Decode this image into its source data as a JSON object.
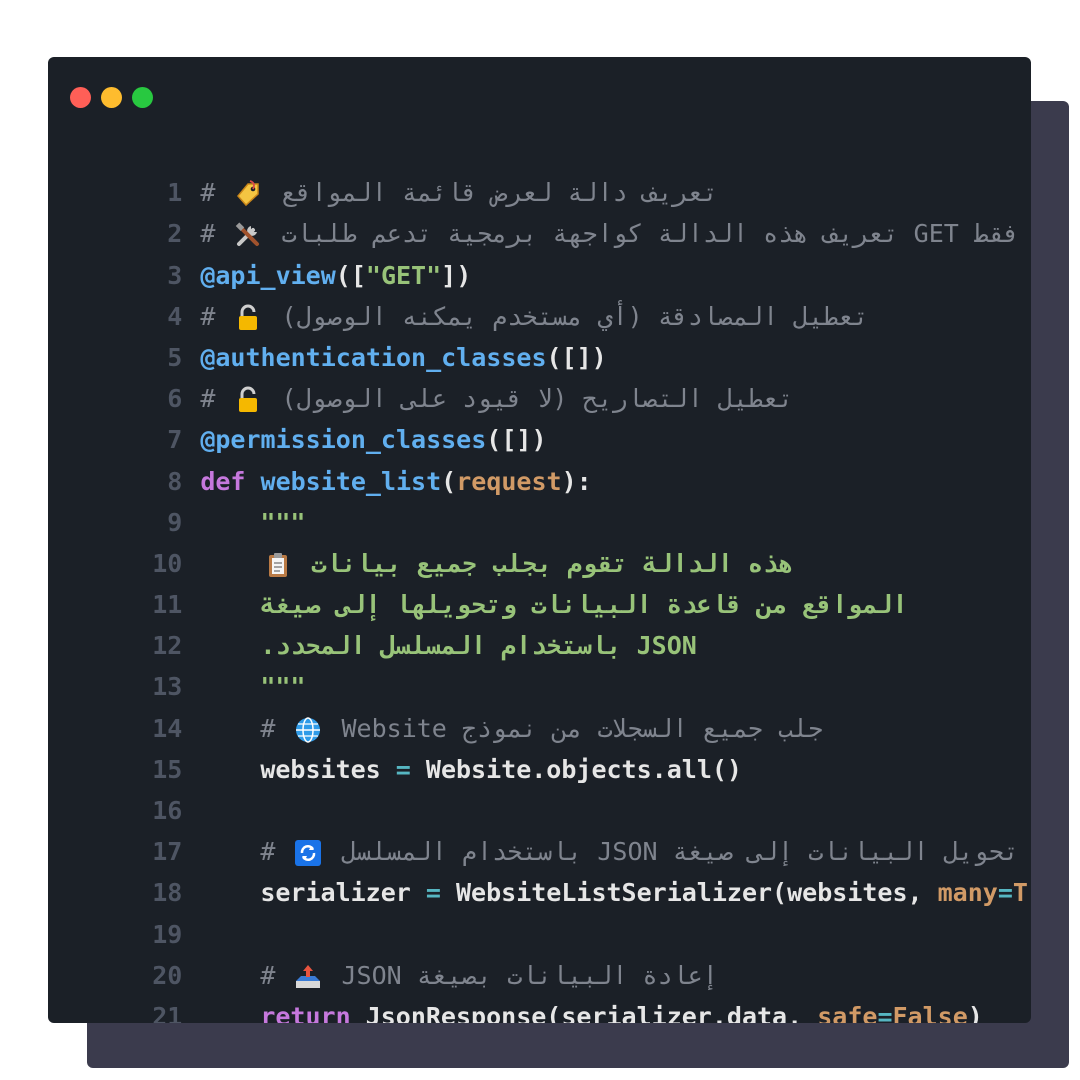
{
  "window": {
    "controls": [
      {
        "name": "close",
        "color": "#ff5f57"
      },
      {
        "name": "minimize",
        "color": "#febc2e"
      },
      {
        "name": "maximize",
        "color": "#28c840"
      }
    ]
  },
  "colors": {
    "background": "#1b2027",
    "shadow": "#3b3b4d",
    "comment": "#7f848e",
    "decorator": "#61afef",
    "keyword": "#c678dd",
    "string": "#98c379",
    "parameter": "#d19a66"
  },
  "lines": [
    {
      "n": "1",
      "hash": "#",
      "icon": "tag-icon",
      "text": "تعريف دالة لعرض قائمة المواقع"
    },
    {
      "n": "2",
      "hash": "#",
      "icon": "tools-icon",
      "text": "فقط GET تعريف هذه الدالة كواجهة برمجية تدعم طلبات"
    },
    {
      "n": "3",
      "decorator": "@api_view",
      "open": "([",
      "arg": "\"GET\"",
      "close": "])"
    },
    {
      "n": "4",
      "hash": "#",
      "icon": "unlock-icon",
      "text": "تعطيل المصادقة (أي مستخدم يمكنه الوصول)"
    },
    {
      "n": "5",
      "decorator": "@authentication_classes",
      "args": "([])"
    },
    {
      "n": "6",
      "hash": "#",
      "icon": "unlock-icon",
      "text": "تعطيل التصاريح (لا قيود على الوصول)"
    },
    {
      "n": "7",
      "decorator": "@permission_classes",
      "args": "([])"
    },
    {
      "n": "8",
      "kw": "def",
      "fn": "website_list",
      "open": "(",
      "param": "request",
      "close": "):"
    },
    {
      "n": "9",
      "doc": "\"\"\""
    },
    {
      "n": "10",
      "icon": "clipboard-icon",
      "doc": "هذه الدالة تقوم بجلب جميع بيانات"
    },
    {
      "n": "11",
      "doc": "المواقع من قاعدة البيانات وتحويلها إلى صيغة"
    },
    {
      "n": "12",
      "doc": "JSON باستخدام المسلسل المحدد."
    },
    {
      "n": "13",
      "doc": "\"\"\""
    },
    {
      "n": "14",
      "hash": "#",
      "icon": "globe-icon",
      "text": "جلب جميع السجلات من نموذج Website"
    },
    {
      "n": "15",
      "lhs": "websites",
      "op": " = ",
      "rhs": "Website.objects.all()"
    },
    {
      "n": "16"
    },
    {
      "n": "17",
      "hash": "#",
      "icon": "refresh-icon",
      "text": "تحويل البيانات إلى صيغة JSON باستخدام المسلسل"
    },
    {
      "n": "18",
      "lhs": "serializer",
      "op": " = ",
      "call": "WebsiteListSerializer(websites, ",
      "kwarg": "many",
      "eq": "=",
      "kwval": "True",
      "close": ")"
    },
    {
      "n": "19"
    },
    {
      "n": "20",
      "hash": "#",
      "icon": "outbox-icon",
      "text": "إعادة البيانات بصيغة JSON"
    },
    {
      "n": "21",
      "kw": "return",
      "call": " JsonResponse(serializer.data, ",
      "kwarg": "safe",
      "eq": "=",
      "kwval": "False",
      "close": ")"
    }
  ]
}
